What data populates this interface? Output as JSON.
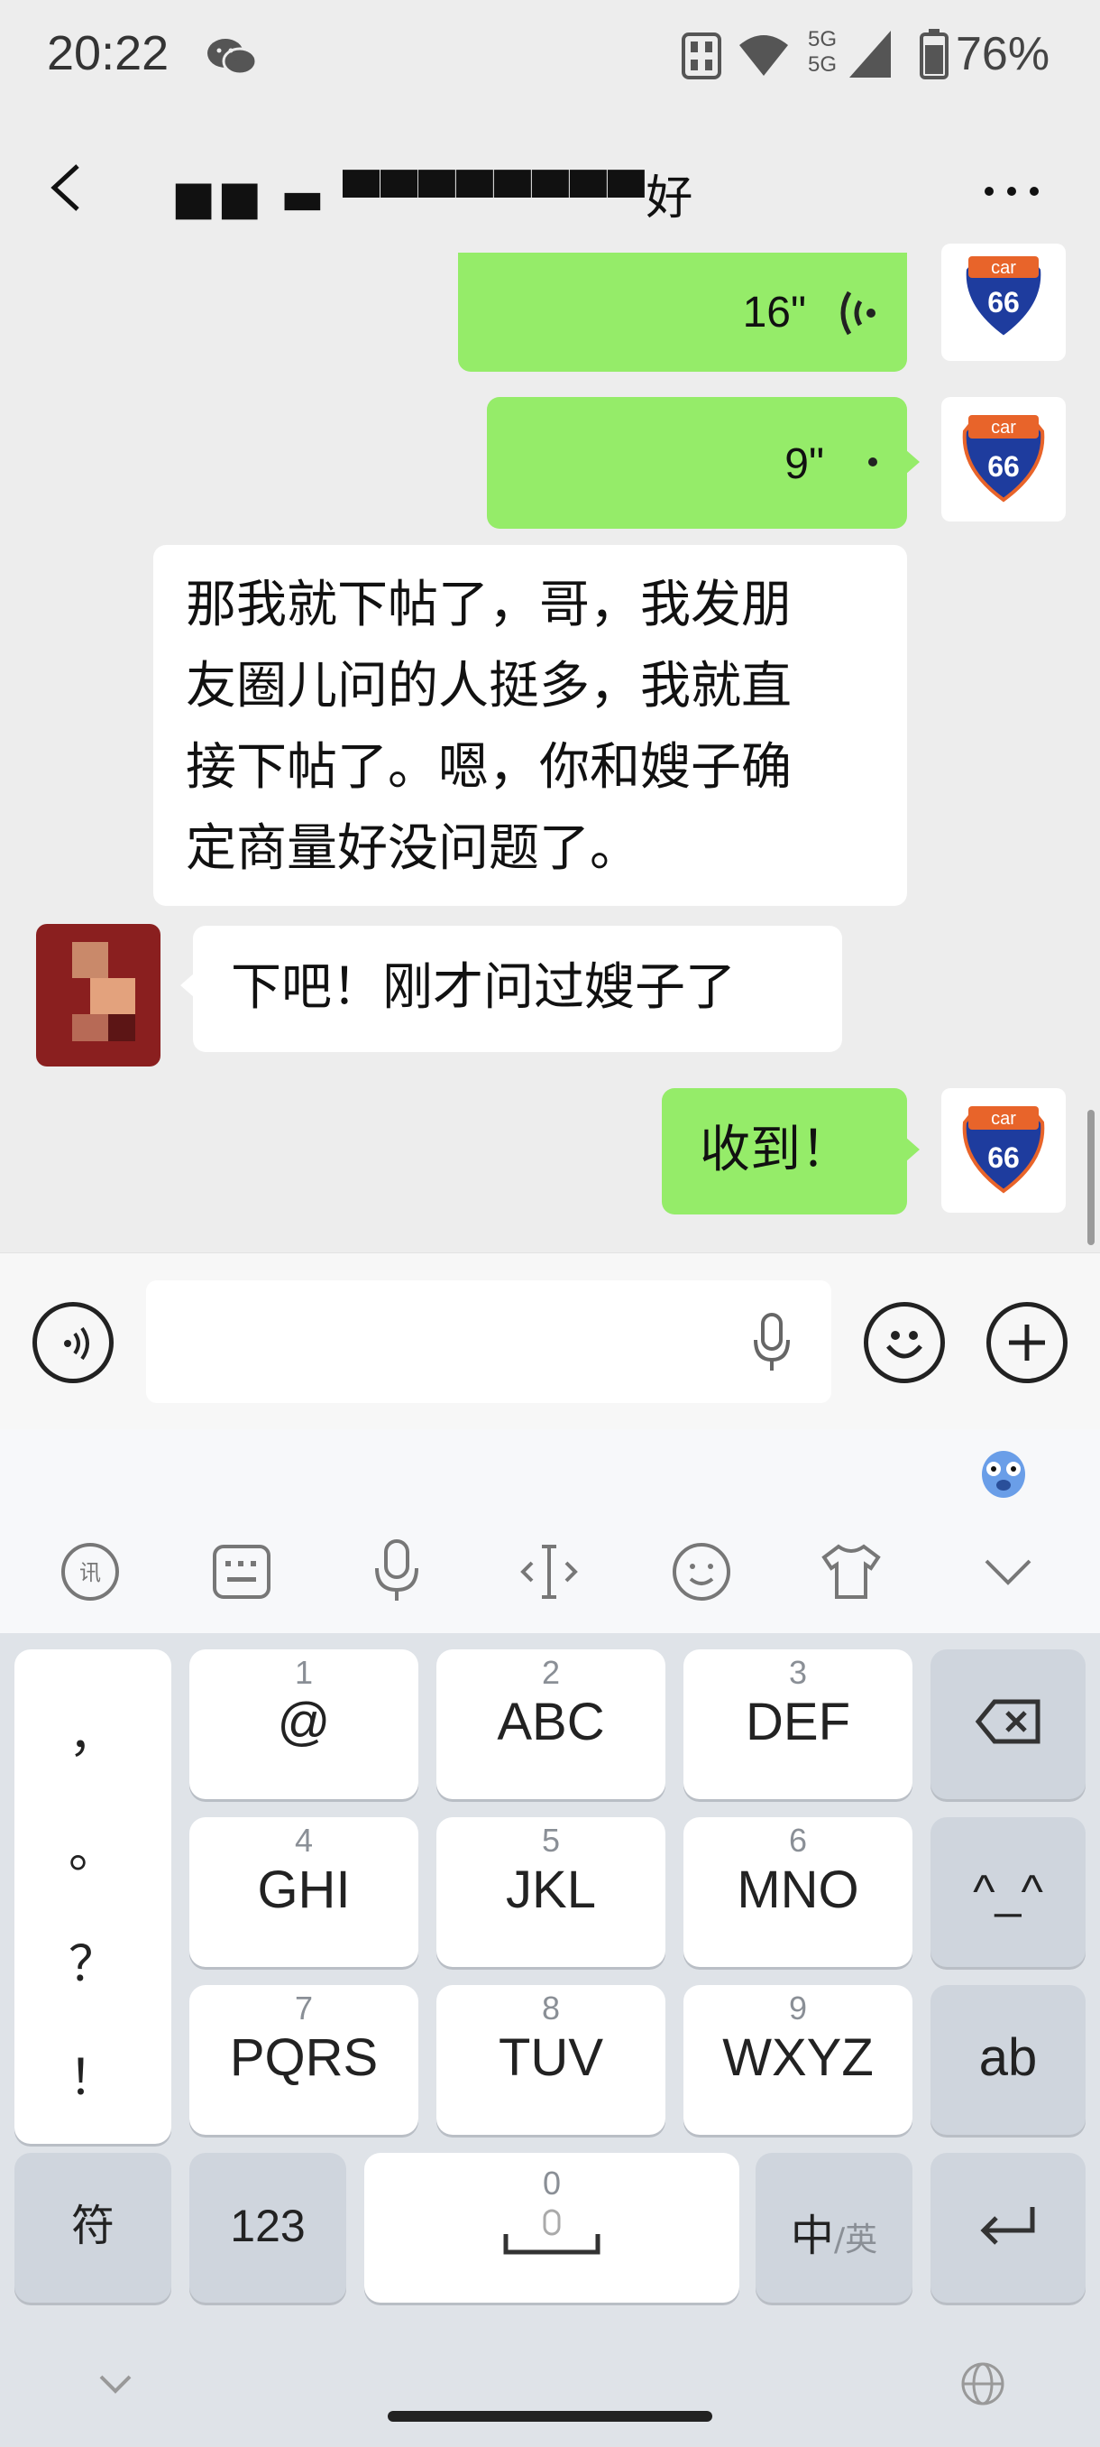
{
  "status_bar": {
    "time": "20:22",
    "battery": "76%",
    "signal_label": "5G"
  },
  "header": {
    "back_icon": "chevron-left-icon",
    "title": "■■ ▬ ▀▀▀▀▀▀▀▀好",
    "more_icon": "more-dots-icon"
  },
  "messages": [
    {
      "side": "right",
      "type": "voice",
      "duration": "16\""
    },
    {
      "side": "right",
      "type": "voice",
      "duration": "9\""
    },
    {
      "side": "right",
      "type": "text",
      "lines": [
        "那我就下帖了，哥，我发朋",
        "友圈儿问的人挺多，我就直",
        "接下帖了。嗯，你和嫂子确",
        "定商量好没问题了。"
      ]
    },
    {
      "side": "left",
      "type": "text",
      "text": "下吧！刚才问过嫂子了"
    },
    {
      "side": "right",
      "type": "text",
      "text": "收到！"
    }
  ],
  "avatar_badge": {
    "top": "car",
    "number": "66"
  },
  "input": {
    "value": "",
    "placeholder": ""
  },
  "ime_toolbar": [
    "ime-logo-icon",
    "keyboard-icon",
    "mic-icon",
    "cursor-icon",
    "emoji-icon",
    "skin-icon",
    "collapse-icon"
  ],
  "keyboard": {
    "symbols": [
      "，",
      "。",
      "？",
      "！"
    ],
    "rows": [
      [
        {
          "num": "1",
          "label": "@"
        },
        {
          "num": "2",
          "label": "ABC"
        },
        {
          "num": "3",
          "label": "DEF"
        }
      ],
      [
        {
          "num": "4",
          "label": "GHI"
        },
        {
          "num": "5",
          "label": "JKL"
        },
        {
          "num": "6",
          "label": "MNO"
        }
      ],
      [
        {
          "num": "7",
          "label": "PQRS"
        },
        {
          "num": "8",
          "label": "TUV"
        },
        {
          "num": "9",
          "label": "WXYZ"
        }
      ]
    ],
    "right_keys": [
      "backspace-icon",
      "^_^",
      "ab"
    ],
    "bottom": {
      "fu": "符",
      "num": "123",
      "space_num": "0",
      "zh": "中",
      "en": "/英",
      "enter_icon": "enter-icon"
    }
  },
  "colors": {
    "my_bubble": "#95ec69",
    "other_bubble": "#ffffff",
    "chat_bg": "#ededed",
    "keyboard_bg": "#dfe3e8"
  }
}
